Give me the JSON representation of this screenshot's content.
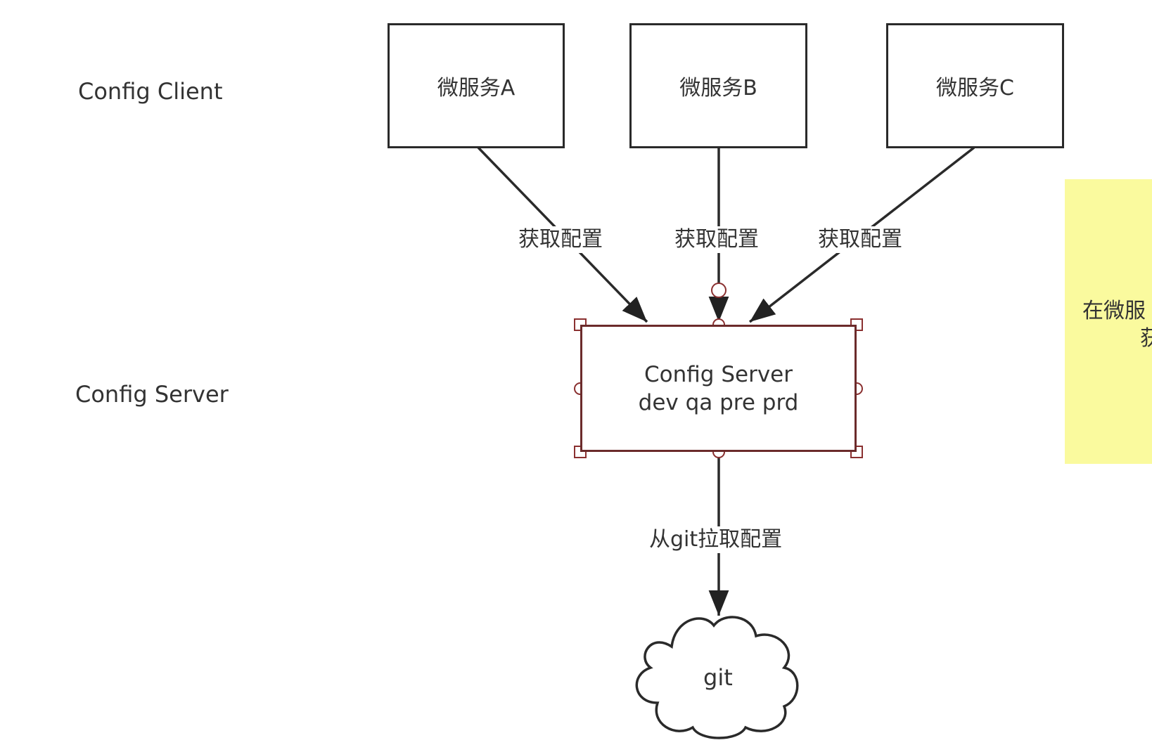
{
  "layers": {
    "client_label": "Config Client",
    "server_label": "Config Server"
  },
  "microservices": [
    {
      "label": "微服务A"
    },
    {
      "label": "微服务B"
    },
    {
      "label": "微服务C"
    }
  ],
  "edges": {
    "fetch_label": "获取配置",
    "pull_label": "从git拉取配置"
  },
  "config_server": {
    "title": "Config Server",
    "environments": "dev qa pre prd"
  },
  "repository": {
    "label": "git"
  },
  "note": {
    "line1": "在微服",
    "line2": "获"
  },
  "colors": {
    "stroke": "#2a2a2a",
    "selection": "#6b2b2b",
    "note_bg": "#fafa9e"
  }
}
